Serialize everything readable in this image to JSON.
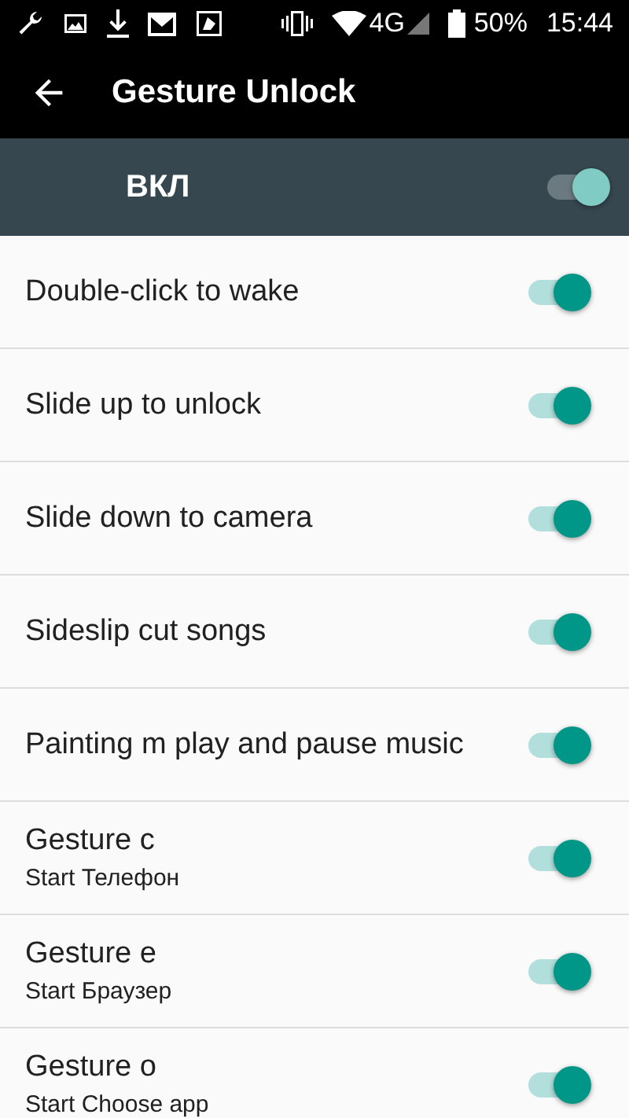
{
  "status_bar": {
    "network": "4G",
    "battery": "50%",
    "time": "15:44"
  },
  "app_bar": {
    "title": "Gesture Unlock"
  },
  "master": {
    "label": "ВКЛ",
    "on": true
  },
  "items": [
    {
      "title": "Double-click to wake",
      "on": true
    },
    {
      "title": "Slide up to unlock",
      "on": true
    },
    {
      "title": "Slide down to camera",
      "on": true
    },
    {
      "title": "Sideslip cut songs",
      "on": true
    },
    {
      "title": "Painting m play and pause music",
      "on": true
    },
    {
      "title": "Gesture c",
      "subtitle": "Start Телефон",
      "on": true
    },
    {
      "title": "Gesture e",
      "subtitle": "Start Браузер",
      "on": true
    },
    {
      "title": "Gesture o",
      "subtitle": "Start Choose app",
      "on": true
    }
  ]
}
